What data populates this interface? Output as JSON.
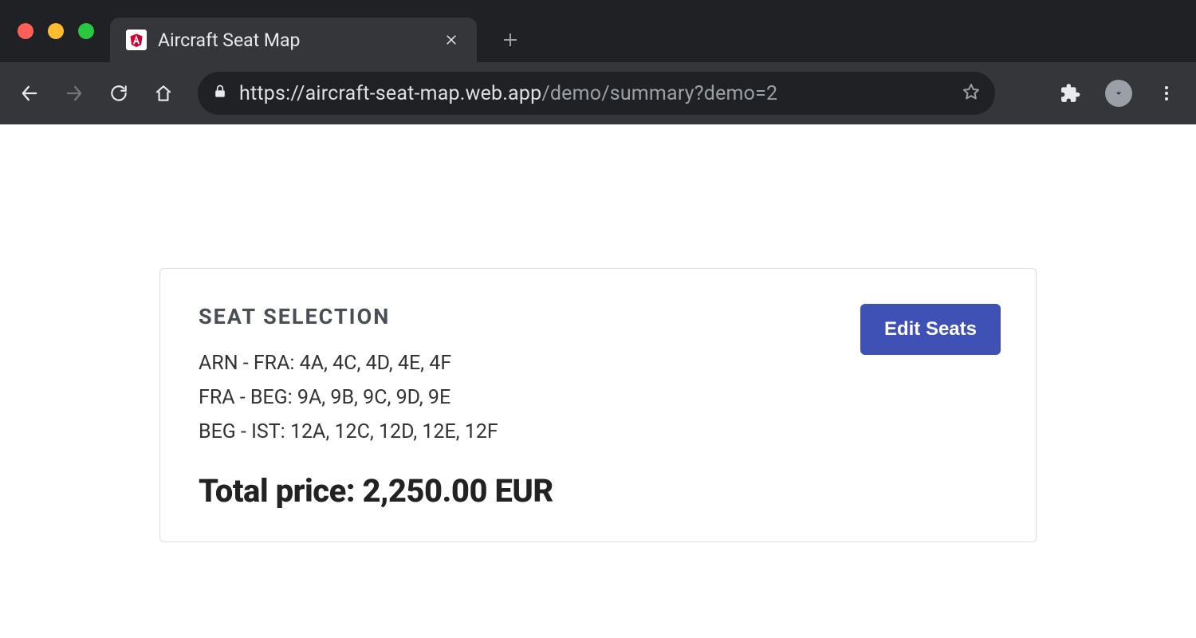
{
  "browser": {
    "tab": {
      "title": "Aircraft Seat Map"
    },
    "url": {
      "scheme": "https://",
      "host": "aircraft-seat-map.web.app",
      "path": "/demo/summary?demo=2"
    }
  },
  "card": {
    "title": "SEAT SELECTION",
    "edit_button": "Edit Seats",
    "routes": [
      "ARN - FRA: 4A, 4C, 4D, 4E, 4F",
      "FRA - BEG: 9A, 9B, 9C, 9D, 9E",
      "BEG - IST: 12A, 12C, 12D, 12E, 12F"
    ],
    "total_label": "Total price:",
    "total_value": "2,250.00 EUR"
  }
}
